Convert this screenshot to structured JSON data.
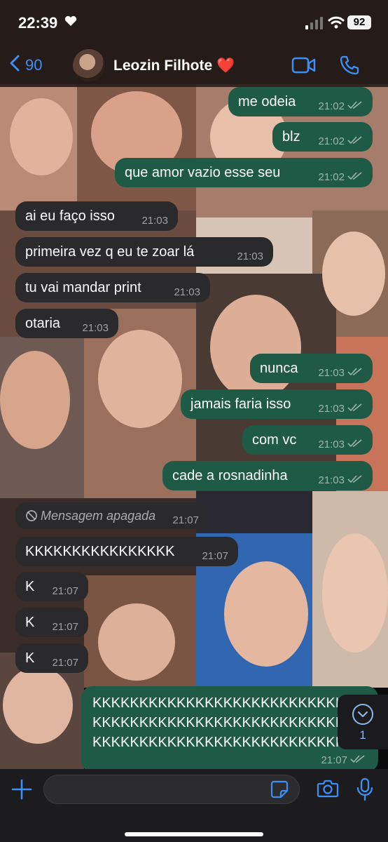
{
  "status_bar": {
    "time": "22:39",
    "battery": "92"
  },
  "header": {
    "back_count": "90",
    "contact_name": "Leozin Filhote ❤️"
  },
  "messages": [
    {
      "dir": "out",
      "text": "me odeia",
      "time": "21:02"
    },
    {
      "dir": "out",
      "text": "blz",
      "time": "21:02"
    },
    {
      "dir": "out",
      "text": "que amor vazio esse seu",
      "time": "21:02"
    },
    {
      "dir": "in",
      "text": "ai eu faço isso",
      "time": "21:03"
    },
    {
      "dir": "in",
      "text": "primeira vez q eu te zoar lá",
      "time": "21:03"
    },
    {
      "dir": "in",
      "text": "tu vai mandar print",
      "time": "21:03"
    },
    {
      "dir": "in",
      "text": "otaria",
      "time": "21:03"
    },
    {
      "dir": "out",
      "text": "nunca",
      "time": "21:03"
    },
    {
      "dir": "out",
      "text": "jamais faria isso",
      "time": "21:03"
    },
    {
      "dir": "out",
      "text": "com vc",
      "time": "21:03"
    },
    {
      "dir": "out",
      "text": "cade a rosnadinha",
      "time": "21:03"
    },
    {
      "dir": "in",
      "text": "Mensagem apagada",
      "time": "21:07",
      "deleted": true
    },
    {
      "dir": "in",
      "text": "KKKKKKKKKKKKKKKK",
      "time": "21:07"
    },
    {
      "dir": "in",
      "text": "K",
      "time": "21:07"
    },
    {
      "dir": "in",
      "text": "K",
      "time": "21:07"
    },
    {
      "dir": "in",
      "text": "K",
      "time": "21:07"
    }
  ],
  "last_message": {
    "lines": [
      "KKKKKKKKKKKKKKKKKKKKKKKKKKK",
      "KKKKKKKKKKKKKKKKKKKKKKKKKKK",
      "KKKKKKKKKKKKKKKKKKKKKKKKKKK"
    ],
    "time": "21:07"
  },
  "scroll_down": {
    "count": "1"
  },
  "input": {
    "placeholder": ""
  },
  "icons": [
    "heart-icon",
    "signal-icon",
    "wifi-icon",
    "back-chevron-icon",
    "video-call-icon",
    "phone-icon",
    "read-ticks-icon",
    "blocked-icon",
    "chevron-down-icon",
    "plus-icon",
    "sticker-icon",
    "camera-icon",
    "microphone-icon"
  ],
  "colors": {
    "outgoing": "#1f5a46",
    "incoming": "#2a2a2c",
    "accent": "#3d8ef5"
  }
}
